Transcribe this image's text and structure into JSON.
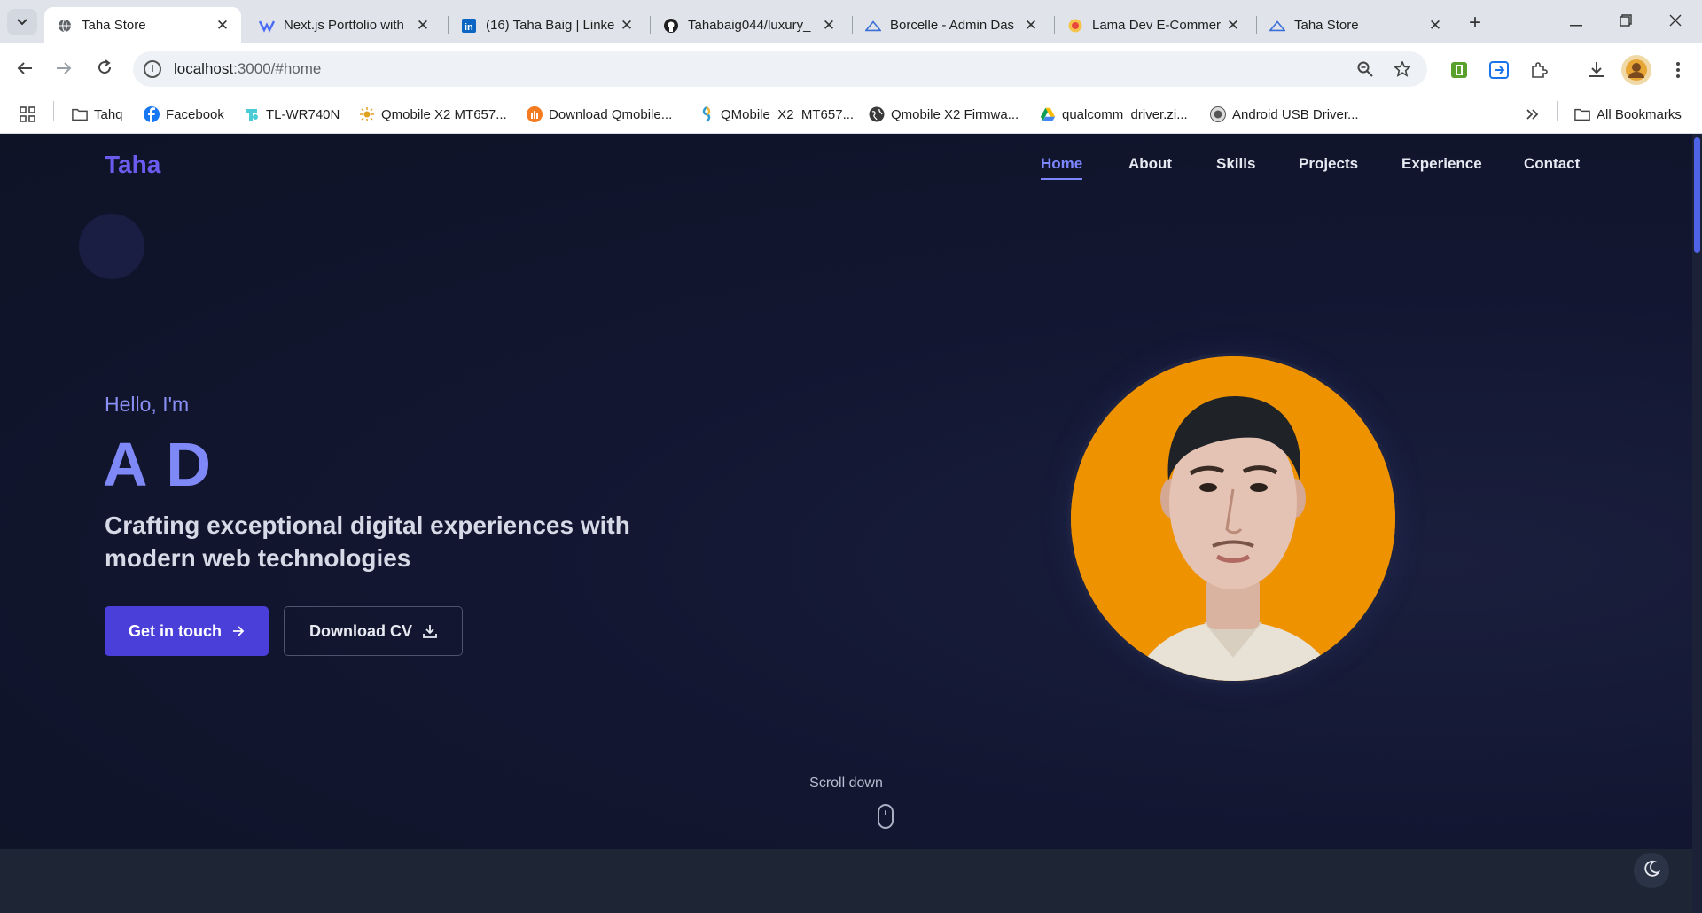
{
  "browser": {
    "tabs": [
      {
        "title": "Taha Store",
        "icon": "globe-icon",
        "active": true
      },
      {
        "title": "Next.js Portfolio with",
        "icon": "app-icon",
        "active": false
      },
      {
        "title": "(16) Taha Baig | Linke",
        "icon": "linkedin-icon",
        "active": false
      },
      {
        "title": "Tahabaig044/luxury_",
        "icon": "github-icon",
        "active": false
      },
      {
        "title": "Borcelle - Admin Das",
        "icon": "vercel-icon",
        "active": false
      },
      {
        "title": "Lama Dev E-Commer",
        "icon": "lama-icon",
        "active": false
      },
      {
        "title": "Taha Store",
        "icon": "vercel-icon",
        "active": false
      }
    ],
    "url_host": "localhost",
    "url_rest": ":3000/#home",
    "bookmarks": [
      {
        "label": "Tahq",
        "icon": "folder-icon"
      },
      {
        "label": "Facebook",
        "icon": "facebook-icon"
      },
      {
        "label": "TL-WR740N",
        "icon": "tplink-icon"
      },
      {
        "label": "Qmobile X2 MT657...",
        "icon": "sun-icon"
      },
      {
        "label": "Download Qmobile...",
        "icon": "chart-icon"
      },
      {
        "label": "QMobile_X2_MT657...",
        "icon": "file-icon"
      },
      {
        "label": "Qmobile X2 Firmwa...",
        "icon": "globe-dark-icon"
      },
      {
        "label": "qualcomm_driver.zi...",
        "icon": "drive-icon"
      },
      {
        "label": "Android USB Driver...",
        "icon": "android-icon"
      }
    ],
    "all_bookmarks": "All Bookmarks"
  },
  "site": {
    "logo": "Taha",
    "nav": [
      "Home",
      "About",
      "Skills",
      "Projects",
      "Experience",
      "Contact"
    ],
    "active_nav": "Home"
  },
  "hero": {
    "greeting": "Hello, I'm",
    "name": "A D",
    "tagline": "Crafting exceptional digital experiences with modern web technologies",
    "primary_button": "Get in touch",
    "secondary_button": "Download CV",
    "scroll_label": "Scroll down"
  },
  "colors": {
    "accent": "#4a3fd8",
    "brand_logo": "#6b5cf0",
    "name": "#7f88f7",
    "page_bg": "#0f1326",
    "avatar_bg": "#ee9200"
  }
}
